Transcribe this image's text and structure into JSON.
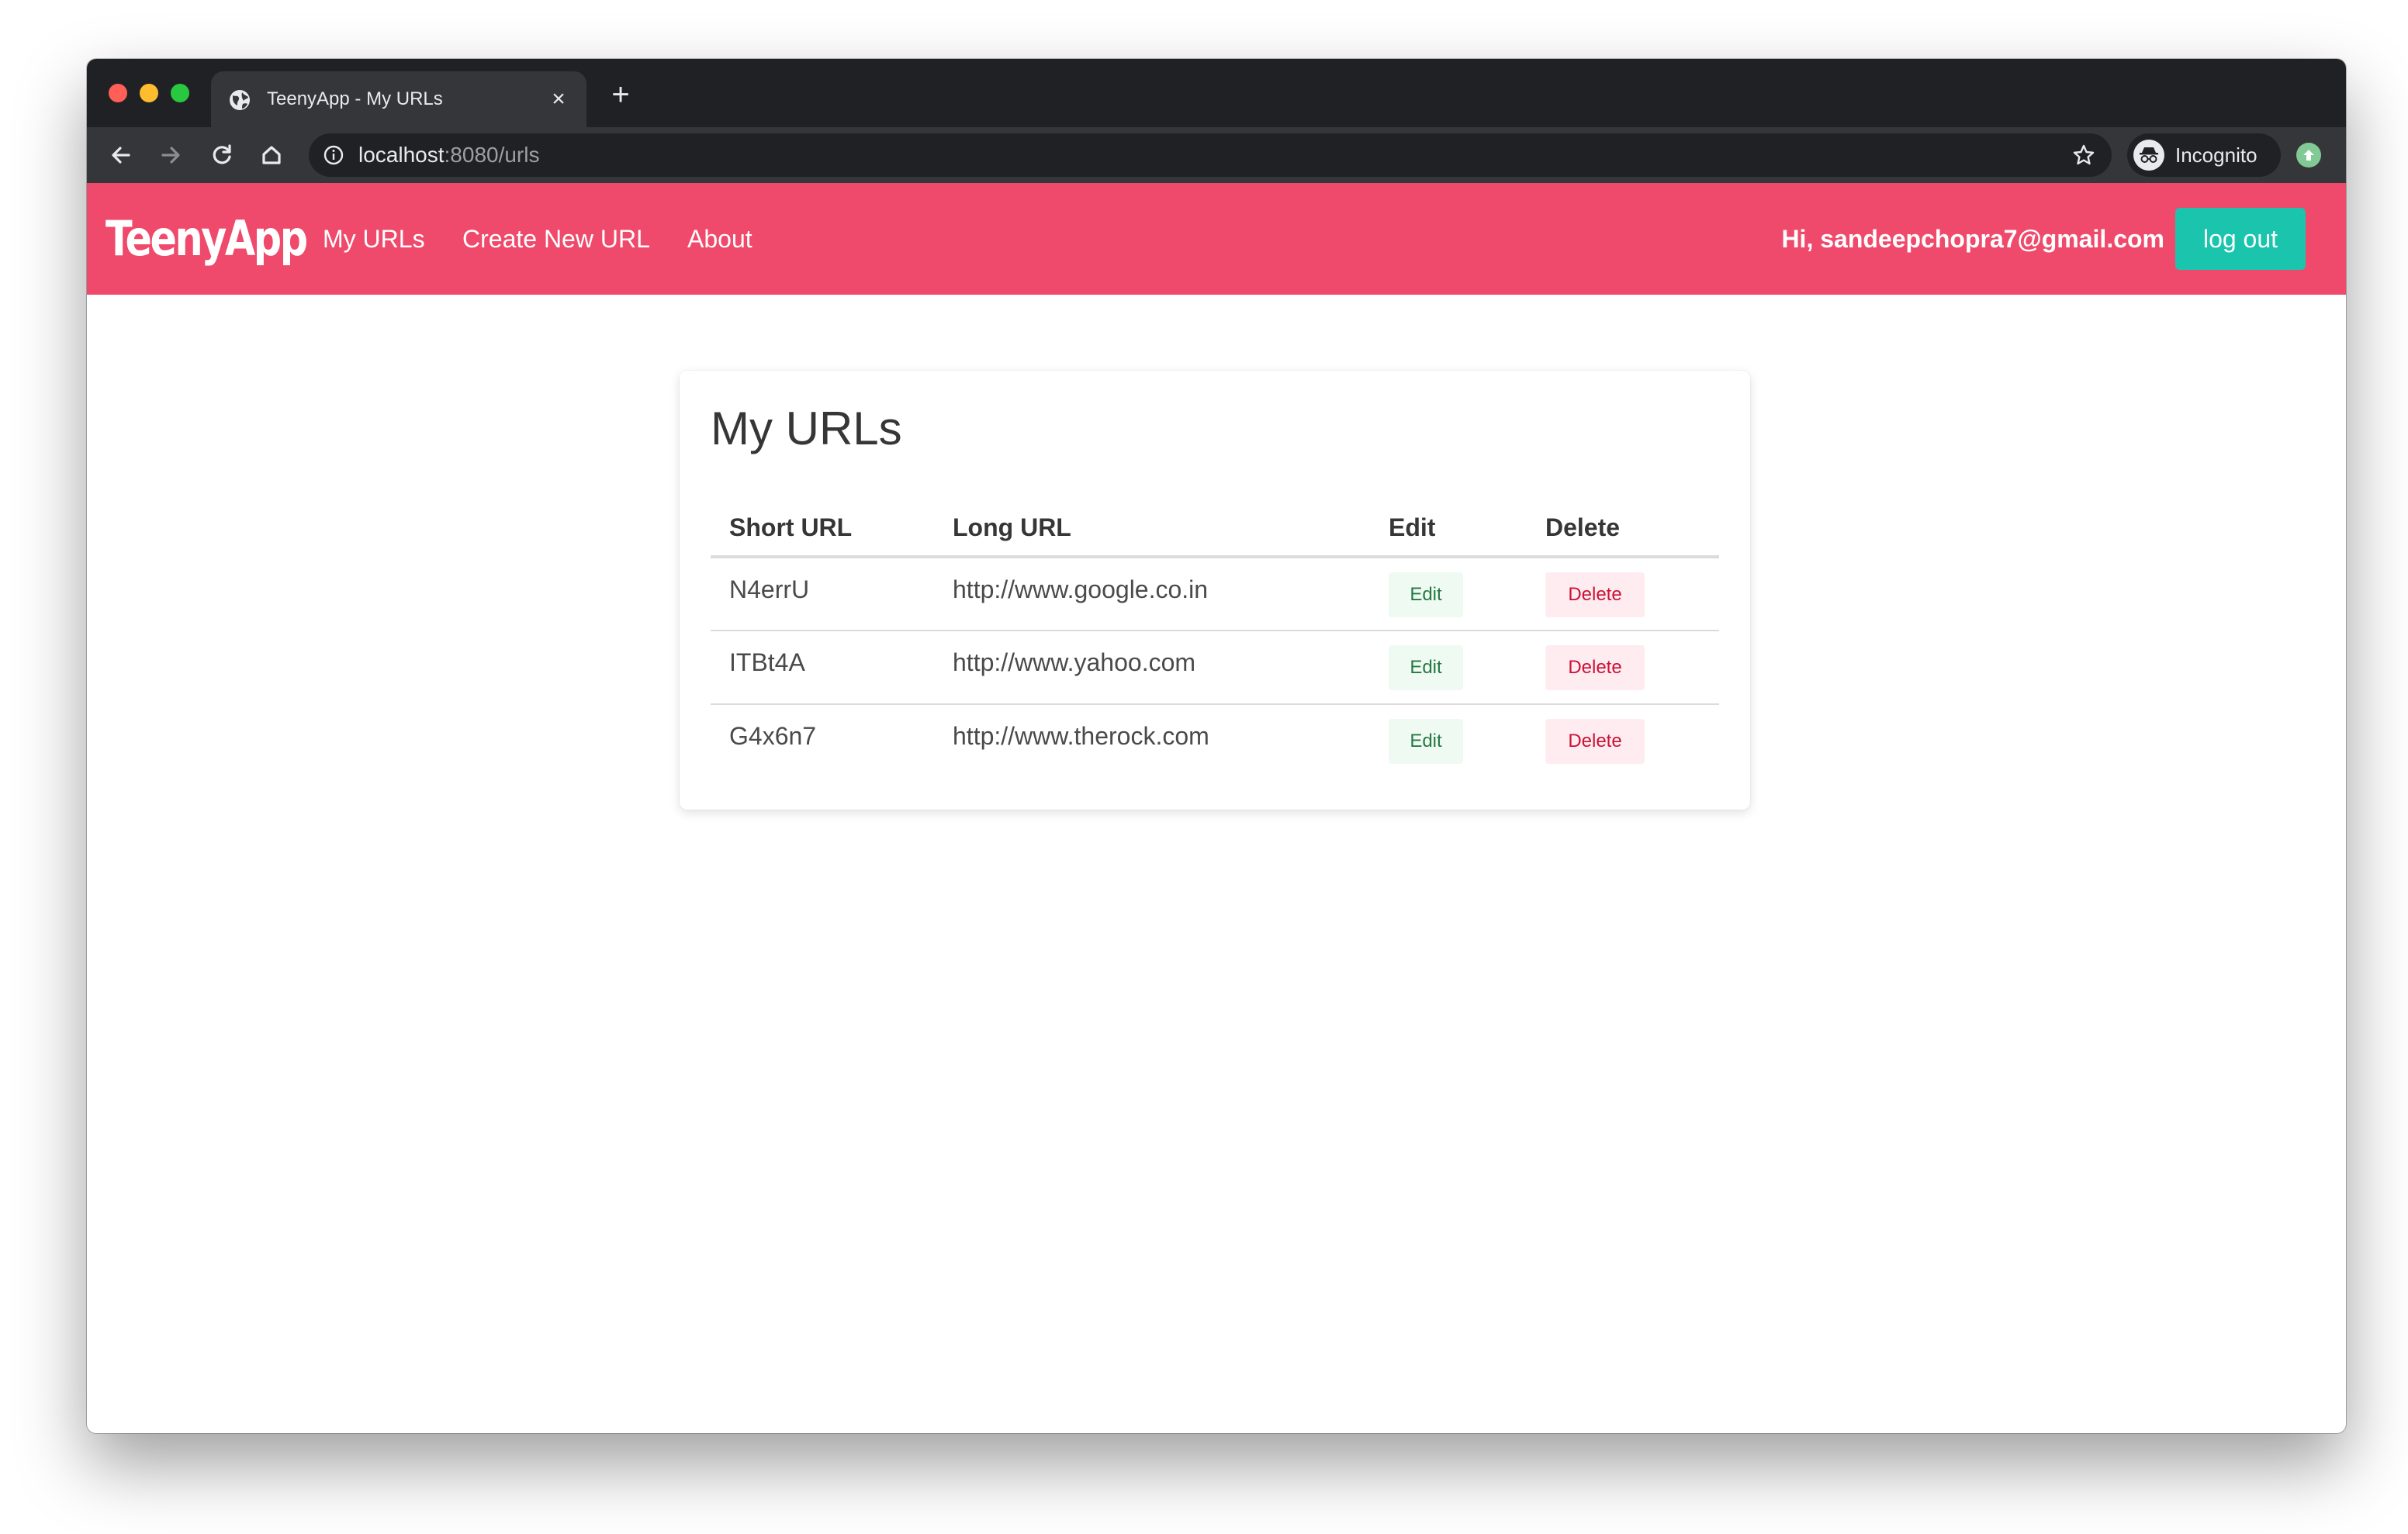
{
  "browser": {
    "tab_title": "TeenyApp - My URLs",
    "tab_close": "×",
    "new_tab": "+",
    "url_host": "localhost",
    "url_rest": ":8080/urls",
    "profile_label": "Incognito"
  },
  "navbar": {
    "brand": "TeenyApp",
    "links": [
      "My URLs",
      "Create New URL",
      "About"
    ],
    "greeting": "Hi, sandeepchopra7@gmail.com",
    "logout_label": "log out",
    "background": "#ef4a6b",
    "logout_color": "#1bc5ad"
  },
  "main": {
    "title": "My URLs",
    "table": {
      "headers": [
        "Short URL",
        "Long URL",
        "Edit",
        "Delete"
      ],
      "rows": [
        {
          "short": "N4errU",
          "long": "http://www.google.co.in",
          "edit": "Edit",
          "delete": "Delete"
        },
        {
          "short": "ITBt4A",
          "long": "http://www.yahoo.com",
          "edit": "Edit",
          "delete": "Delete"
        },
        {
          "short": "G4x6n7",
          "long": "http://www.therock.com",
          "edit": "Edit",
          "delete": "Delete"
        }
      ]
    }
  }
}
